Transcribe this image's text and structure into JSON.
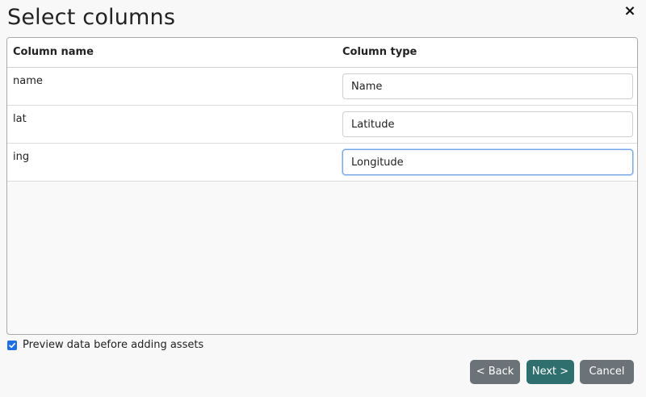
{
  "dialog": {
    "title": "Select columns",
    "close_label": "×"
  },
  "table": {
    "headers": {
      "column_name": "Column name",
      "column_type": "Column type"
    },
    "rows": [
      {
        "name": "name",
        "type": "Name"
      },
      {
        "name": "lat",
        "type": "Latitude"
      },
      {
        "name": "ing",
        "type": "Longitude"
      }
    ]
  },
  "options": {
    "preview_label": "Preview data before adding assets",
    "preview_checked": true
  },
  "buttons": {
    "back": "< Back",
    "next": "Next >",
    "cancel": "Cancel"
  },
  "colors": {
    "checkbox": "#1f6fe0",
    "next_button": "#2f6f6e",
    "secondary_button": "#6b7378",
    "focus_border": "#7aa7e6"
  }
}
